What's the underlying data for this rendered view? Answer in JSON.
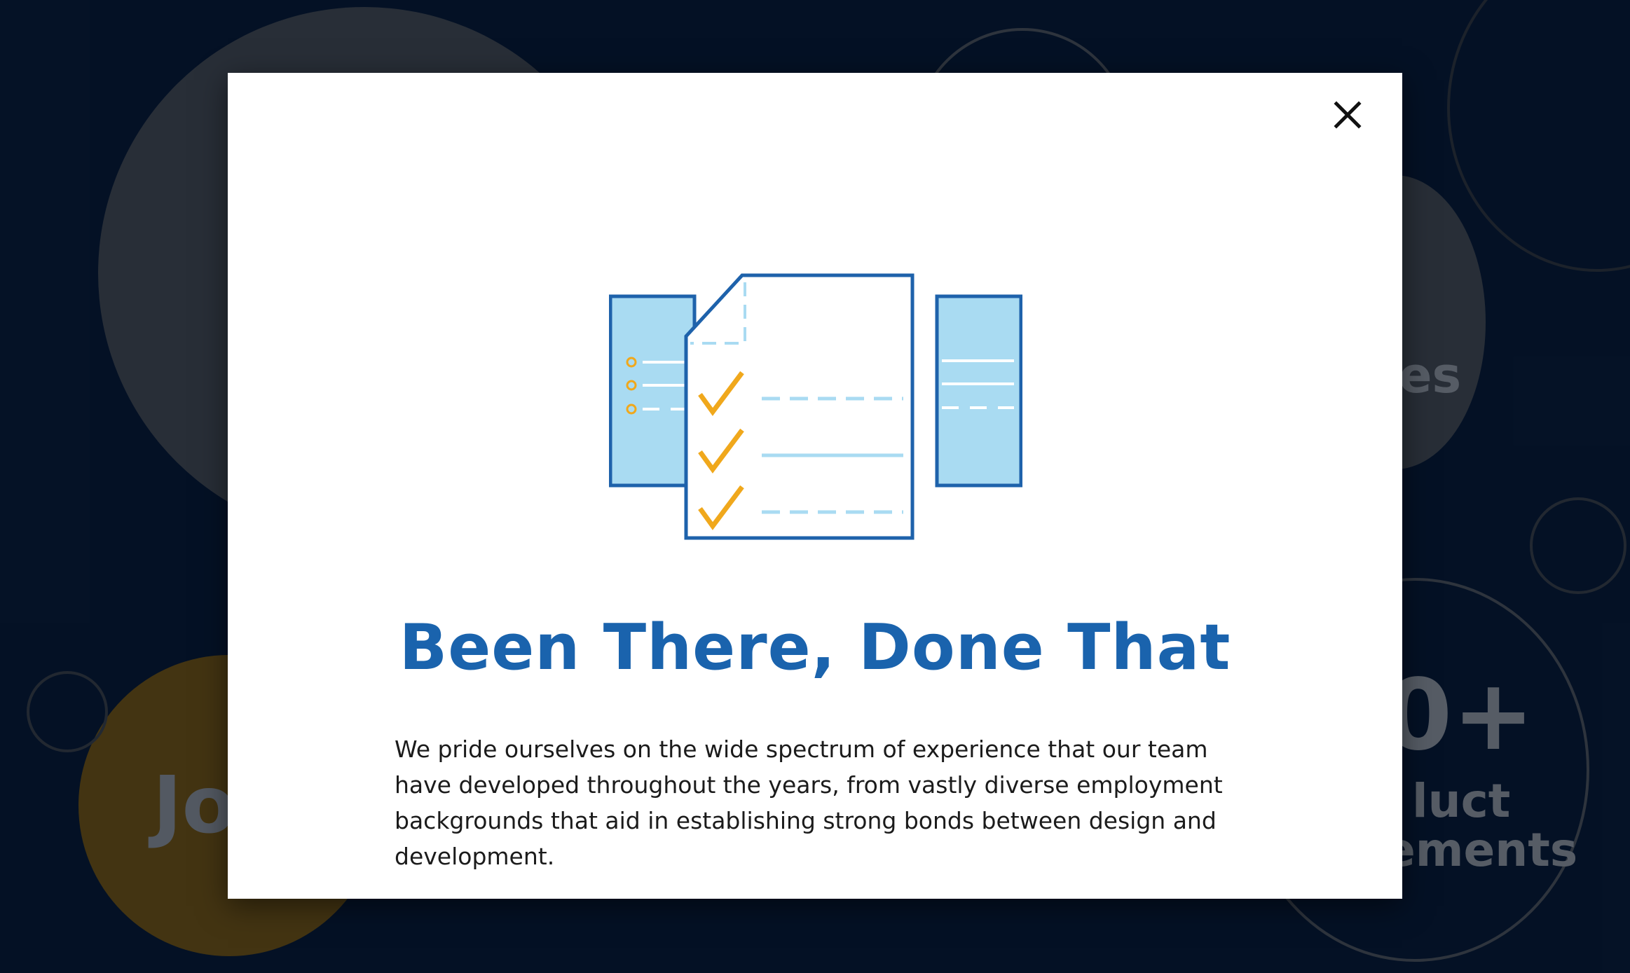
{
  "background": {
    "text_1": "Jo",
    "text_2": "es",
    "text_3": "0+",
    "text_4": "luct",
    "text_5": "ements"
  },
  "modal": {
    "close_label": "×",
    "illustration": "checklist-document-icon",
    "title": "Been There, Done That",
    "body": "We pride ourselves on the wide spectrum of experience that our team have developed throughout the years, from vastly diverse employment backgrounds that aid in establishing strong bonds between design and development."
  },
  "colors": {
    "backdrop": "#0d1f3b",
    "title": "#1a63ad",
    "accent_orange": "#f0a81c",
    "light_blue": "#a9dbf2",
    "outline_blue": "#1e62ab"
  }
}
